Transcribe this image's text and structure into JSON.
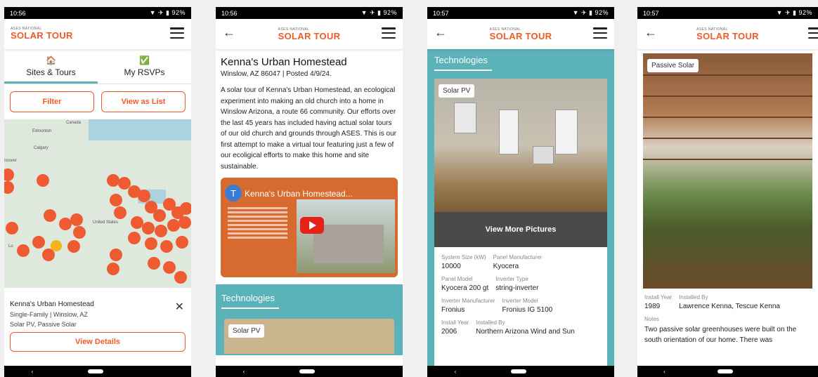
{
  "common": {
    "logo_top": "ASES NATIONAL",
    "logo_main": "SOLAR TOUR",
    "battery": "92%"
  },
  "screen1": {
    "time": "10:56",
    "tabs": [
      {
        "icon": "🏠",
        "label": "Sites & Tours"
      },
      {
        "icon": "✅",
        "label": "My RSVPs"
      }
    ],
    "filter_label": "Filter",
    "view_as_list_label": "View as List",
    "map_labels": {
      "canada": "Canada",
      "edmonton": "Edmonton",
      "calgary": "Calgary",
      "couver": "couver",
      "united_states": "United States",
      "lo": "Lo"
    },
    "card": {
      "title": "Kenna's Urban Homestead",
      "line1": "Single-Family | Winslow, AZ",
      "line2": "Solar PV, Passive Solar",
      "view_details_label": "View Details"
    }
  },
  "screen2": {
    "time": "10:56",
    "title": "Kenna's Urban Homestead",
    "meta": "Winslow, AZ 86047 | Posted 4/9/24.",
    "description": "A solar tour of Kenna's Urban Homestead, an ecological experiment into making an old church into a home in Winslow Arizona, a route 66 community. Our efforts over the last 45 years has included having actual solar tours of our old church and grounds through ASES. This is our first attempt to make a virtual tour featuring just a few of our ecoligical efforts to make this home and site sustainable.",
    "video": {
      "channel_initial": "T",
      "title": "Kenna's Urban Homestead..."
    },
    "technologies_label": "Technologies",
    "tech_chip": "Solar PV"
  },
  "screen3": {
    "time": "10:57",
    "technologies_label": "Technologies",
    "chip": "Solar PV",
    "view_more_label": "View More Pictures",
    "specs": [
      [
        {
          "k": "System Size (kW)",
          "v": "10000"
        },
        {
          "k": "Panel Manufacturer",
          "v": "Kyocera"
        }
      ],
      [
        {
          "k": "Panel Model",
          "v": "Kyocera 200 gt"
        },
        {
          "k": "Inverter Type",
          "v": "string-inverter"
        }
      ],
      [
        {
          "k": "Inverter Manufacturer",
          "v": "Fronius"
        },
        {
          "k": "Inverter Model",
          "v": "Fronius IG 5100"
        }
      ],
      [
        {
          "k": "Install Year",
          "v": "2006"
        },
        {
          "k": "Installed By",
          "v": "Northern Arizona Wind and Sun"
        }
      ]
    ]
  },
  "screen4": {
    "time": "10:57",
    "chip": "Passive Solar",
    "install_year_label": "Install Year",
    "install_year": "1989",
    "installed_by_label": "Installed By",
    "installed_by": "Lawrence Kenna, Tescue Kenna",
    "notes_label": "Notes",
    "notes": "Two passive solar greenhouses were built on the south orientation of our home. There was"
  },
  "colors": {
    "accent": "#f05a28",
    "teal": "#5bb2b8",
    "pin": "#ee5a31",
    "pin_selected": "#f5b21a"
  }
}
